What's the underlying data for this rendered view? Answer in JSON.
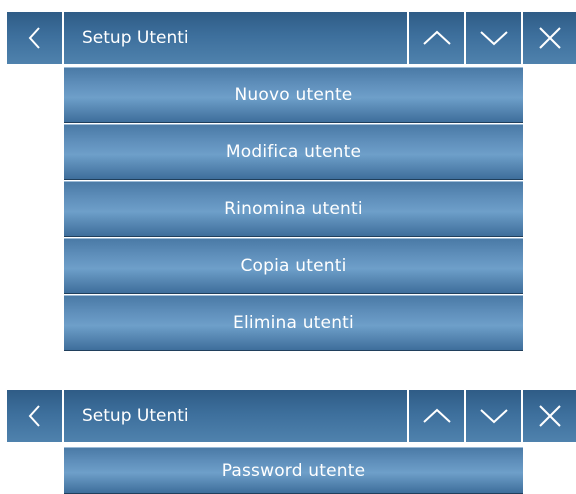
{
  "screens": [
    {
      "header": {
        "back_icon": "chevron-left-icon",
        "title": "Setup Utenti",
        "up_icon": "chevron-up-icon",
        "down_icon": "chevron-down-icon",
        "close_icon": "close-icon"
      },
      "menu": [
        {
          "label": "Nuovo utente"
        },
        {
          "label": "Modifica utente"
        },
        {
          "label": "Rinomina utenti"
        },
        {
          "label": "Copia utenti"
        },
        {
          "label": "Elimina utenti"
        }
      ]
    },
    {
      "header": {
        "back_icon": "chevron-left-icon",
        "title": "Setup Utenti",
        "up_icon": "chevron-up-icon",
        "down_icon": "chevron-down-icon",
        "close_icon": "close-icon"
      },
      "menu": [
        {
          "label": "Password utente"
        }
      ]
    }
  ],
  "colors": {
    "header": "#3d6f9c",
    "button": "#5f8fbb",
    "text": "#ffffff"
  }
}
